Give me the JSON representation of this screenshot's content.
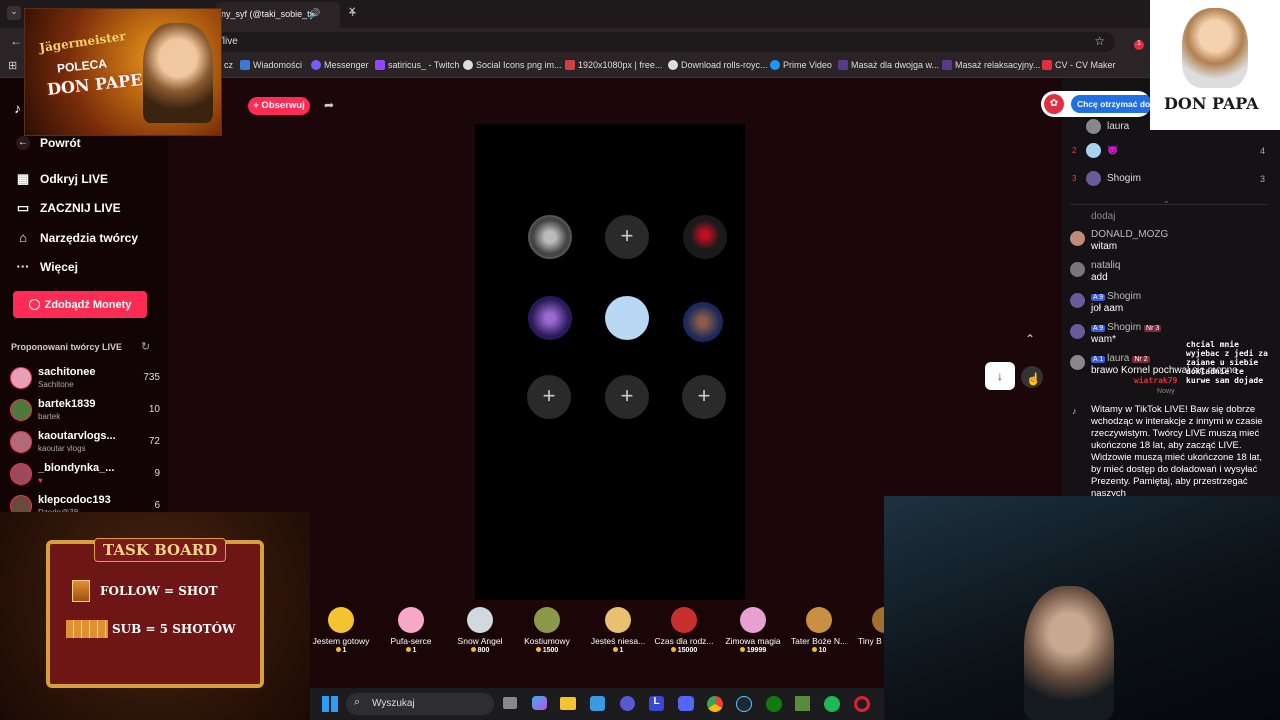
{
  "browser": {
    "tab_title": "ny_syf (@taki_sobie_ty",
    "url": "/live",
    "bookmarks": [
      "cz",
      "Wiadomości",
      "Messenger",
      "satiricus_ - Twitch",
      "Social Icons png im...",
      "1920x1080px | free...",
      "Download rolls-royc...",
      "Prime Video",
      "Masaż dla dwojga w...",
      "Masaż relaksacyjny...",
      "CV - CV Maker"
    ],
    "badge_count": "1"
  },
  "header": {
    "follow_label": "+ Obserwuj",
    "cta_label": "Chcę otrzymać do"
  },
  "sidebar": {
    "back_label": "Powrót",
    "items": [
      {
        "label": "Odkryj LIVE",
        "icon": "live-icon"
      },
      {
        "label": "ZACZNIJ LIVE",
        "icon": "camera-icon"
      },
      {
        "label": "Narzędzia twórcy",
        "icon": "lightbulb-icon"
      },
      {
        "label": "Więcej",
        "icon": "more-icon"
      }
    ],
    "coins_label": "Zdobądź Monety",
    "suggested_title": "Proponowani twórcy LIVE",
    "creators": [
      {
        "name": "sachitonee",
        "sub": "Sachitone",
        "count": "735",
        "color": "#e6a0b8"
      },
      {
        "name": "bartek1839",
        "sub": "bartek",
        "count": "10",
        "color": "#4c7a3a"
      },
      {
        "name": "kaoutarvlogs...",
        "sub": "kaoutar vlogs",
        "count": "72",
        "color": "#b06a7a"
      },
      {
        "name": "_blondynka_...",
        "sub": "♥",
        "count": "9",
        "color": "#9a4a5a"
      },
      {
        "name": "klepcodoc193",
        "sub": "Dzedo@38",
        "count": "6",
        "color": "#6a4a3a"
      }
    ]
  },
  "chat": {
    "ranking": [
      {
        "rank": "",
        "name": "laura",
        "score": "",
        "color": "#888"
      },
      {
        "rank": "2",
        "name": "😈",
        "score": "4",
        "color": "#a8d4f0"
      },
      {
        "rank": "3",
        "name": "Shogim",
        "score": "3",
        "color": "#6a5a9a"
      }
    ],
    "messages": [
      {
        "user": "dodaj",
        "text": "",
        "color": ""
      },
      {
        "user": "DONALD_MOZG",
        "text": "witam",
        "color": "#c08a7a",
        "badge": "",
        "badge2": ""
      },
      {
        "user": "nataliq",
        "text": "add",
        "color": "#777",
        "badge": "",
        "badge2": ""
      },
      {
        "user": "Shogim",
        "text": "joł aam",
        "color": "#6a5a9a",
        "badge": "A 9",
        "badge2": ""
      },
      {
        "user": "Shogim",
        "text": "wam*",
        "color": "#6a5a9a",
        "badge": "A 9",
        "badge2": "Nr 3"
      },
      {
        "user": "laura",
        "text": "brawo Kornel pochwal się mocno",
        "color": "#888",
        "badge": "A 1",
        "badge2": "Nr 2"
      }
    ],
    "new_label": "Nowy",
    "system_text": "Witamy w TikTok LIVE! Baw się dobrze wchodząc w interakcje z innymi w czasie rzeczywistym. Twórcy LIVE muszą mieć ukończone 18 lat, aby zacząć LIVE. Widzowie muszą mieć ukończone 18 lat, by mieć dostęp do doładowań i wysyłać Prezenty. Pamiętaj, aby przestrzegać naszych",
    "overlay_text": "chcial mnie wyjebac z jedi za zaiane u siebie dokladnie te kurwe sam dojade",
    "overlay_user": "wiatrak79"
  },
  "gifts": [
    {
      "label": "Jestem gotowy",
      "price": "1",
      "color": "#f4c430"
    },
    {
      "label": "Pufa-serce",
      "price": "1",
      "color": "#f7a8c8"
    },
    {
      "label": "Snow Angel",
      "price": "800",
      "color": "#d0d8e0"
    },
    {
      "label": "Kostiumowy",
      "price": "1500",
      "color": "#8a9a4a"
    },
    {
      "label": "Jesteś niesa...",
      "price": "1",
      "color": "#e8c070"
    },
    {
      "label": "Czas dla rodz...",
      "price": "15000",
      "color": "#c83030"
    },
    {
      "label": "Zimowa magia",
      "price": "19999",
      "color": "#e8a0d0"
    },
    {
      "label": "Tater Boże N...",
      "price": "10",
      "color": "#c89040"
    },
    {
      "label": "Tiny B",
      "price": "",
      "color": "#a07030"
    }
  ],
  "taskbar": {
    "search_placeholder": "Wyszukaj"
  },
  "overlays": {
    "promo_line1": "Jägermeister",
    "promo_line2": "POLECA",
    "promo_line3": "DON PAPE",
    "brand": "DON PAPA",
    "taskboard_title": "TASK BOARD",
    "task1": "FOLLOW = SHOT",
    "task2": "SUB = 5 SHOTÓW"
  }
}
